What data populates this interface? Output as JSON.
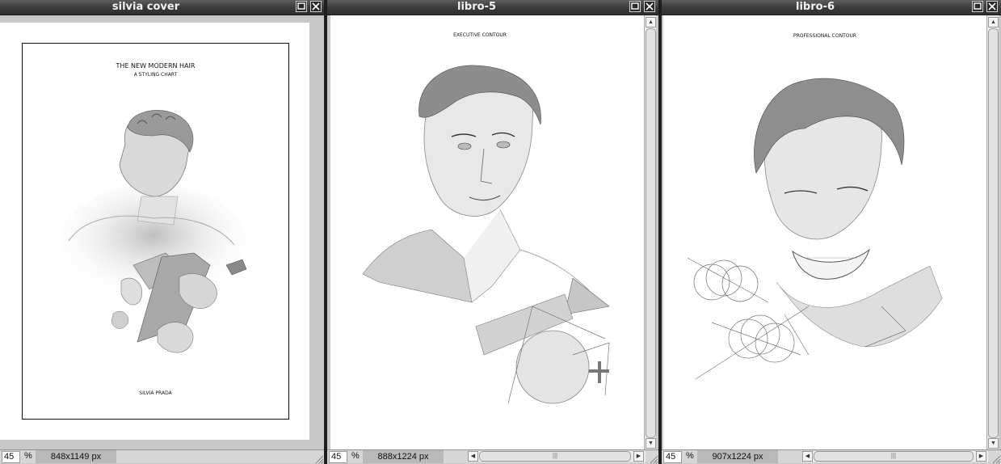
{
  "windows": [
    {
      "title": "silvia cover",
      "zoom": "45",
      "zoom_unit": "%",
      "dimensions": "848x1149 px",
      "page": {
        "title": "THE NEW MODERN HAIR",
        "subtitle": "A STYLING CHART",
        "author": "SILVIA PRADA"
      }
    },
    {
      "title": "libro-5",
      "zoom": "45",
      "zoom_unit": "%",
      "dimensions": "888x1224 px",
      "page": {
        "heading": "EXECUTIVE CONTOUR"
      }
    },
    {
      "title": "libro-6",
      "zoom": "45",
      "zoom_unit": "%",
      "dimensions": "907x1224 px",
      "page": {
        "heading": "PROFESSIONAL CONTOUR"
      }
    }
  ],
  "icons": {
    "maximize": "maximize-icon",
    "close": "close-icon"
  },
  "colors": {
    "titlebar": "#3a3a3a",
    "window_bg": "#c8c8c8",
    "canvas": "#ffffff",
    "status_bar": "#d6d6d6"
  }
}
